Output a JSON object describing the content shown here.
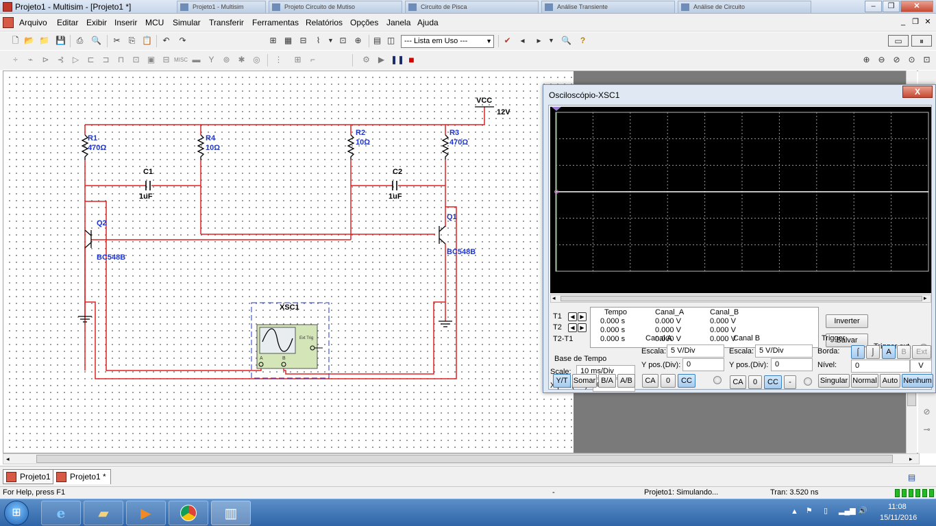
{
  "window": {
    "title": "Projeto1 - Multisim - [Projeto1 *]",
    "background_tabs": [
      "Projeto1 - Multisim",
      "Projeto Circuito de Mutiso",
      "Circuito de Pisca",
      "Análise Transiente",
      "Análise de Circuito"
    ]
  },
  "menu": {
    "items": [
      "Arquivo",
      "Editar",
      "Exibir",
      "Inserir",
      "MCU",
      "Simular",
      "Transferir",
      "Ferramentas",
      "Relatórios",
      "Opções",
      "Janela",
      "Ajuda"
    ]
  },
  "toolbar": {
    "in_use_list": "--- Lista em Uso ---"
  },
  "circuit": {
    "vcc_label": "VCC",
    "vcc_value": "12V",
    "r1_name": "R1",
    "r1_value": "470Ω",
    "r4_name": "R4",
    "r4_value": "10Ω",
    "r2_name": "R2",
    "r2_value": "10Ω",
    "r3_name": "R3",
    "r3_value": "470Ω",
    "c1_name": "C1",
    "c1_value": "1uF",
    "c2_name": "C2",
    "c2_value": "1uF",
    "q1_name": "Q1",
    "q1_model": "BC548B",
    "q2_name": "Q2",
    "q2_model": "BC548B",
    "xsc_name": "XSC1",
    "xsc_ext": "Ext Trig",
    "xsc_a": "A",
    "xsc_b": "B",
    "wire_color": "#e02020",
    "label_color": "#1f35c9"
  },
  "tabs": [
    "Projeto1",
    "Projeto1 *"
  ],
  "status": {
    "help": "For Help, press F1",
    "dash": "-",
    "simulating": "Projeto1: Simulando...",
    "tran": "Tran: 3.520 ns"
  },
  "taskbar": {
    "time": "11:08",
    "date": "15/11/2016"
  },
  "oscilloscope": {
    "title": "Osciloscópio-XSC1",
    "close": "X",
    "readout": {
      "headers": [
        "Tempo",
        "Canal_A",
        "Canal_B"
      ],
      "rows": [
        {
          "label": "T1",
          "tempo": "0.000 s",
          "a": "0.000 V",
          "b": "0.000 V"
        },
        {
          "label": "T2",
          "tempo": "0.000 s",
          "a": "0.000 V",
          "b": "0.000 V"
        },
        {
          "label": "T2-T1",
          "tempo": "0.000 s",
          "a": "0.000 V",
          "b": "0.000 V"
        }
      ]
    },
    "invert_button": "Inverter",
    "save_button": "Salvar",
    "trigger_ext": "Trigger ext.",
    "timebase": {
      "title": "Base de Tempo",
      "scale_label": "Scale:",
      "scale_value": "10 ms/Div",
      "xpos_label": "X pos.(Div):",
      "xpos_value": "0",
      "buttons": [
        "Y/T",
        "Somar",
        "B/A",
        "A/B"
      ]
    },
    "channel_a": {
      "title": "Canal A",
      "scale_label": "Escala:",
      "scale_value": "5  V/Div",
      "ypos_label": "Y pos.(Div):",
      "ypos_value": "0",
      "buttons": [
        "CA",
        "0",
        "CC"
      ]
    },
    "channel_b": {
      "title": "Canal B",
      "scale_label": "Escala:",
      "scale_value": "5  V/Div",
      "ypos_label": "Y pos.(Div):",
      "ypos_value": "0",
      "buttons": [
        "CA",
        "0",
        "CC",
        "-"
      ]
    },
    "trigger": {
      "title": "Trigger",
      "edge_label": "Borda:",
      "source_buttons": [
        "A",
        "B",
        "Ext"
      ],
      "level_label": "Nível:",
      "level_value": "0",
      "level_unit": "V",
      "mode_buttons": [
        "Singular",
        "Normal",
        "Auto",
        "Nenhum"
      ]
    }
  }
}
